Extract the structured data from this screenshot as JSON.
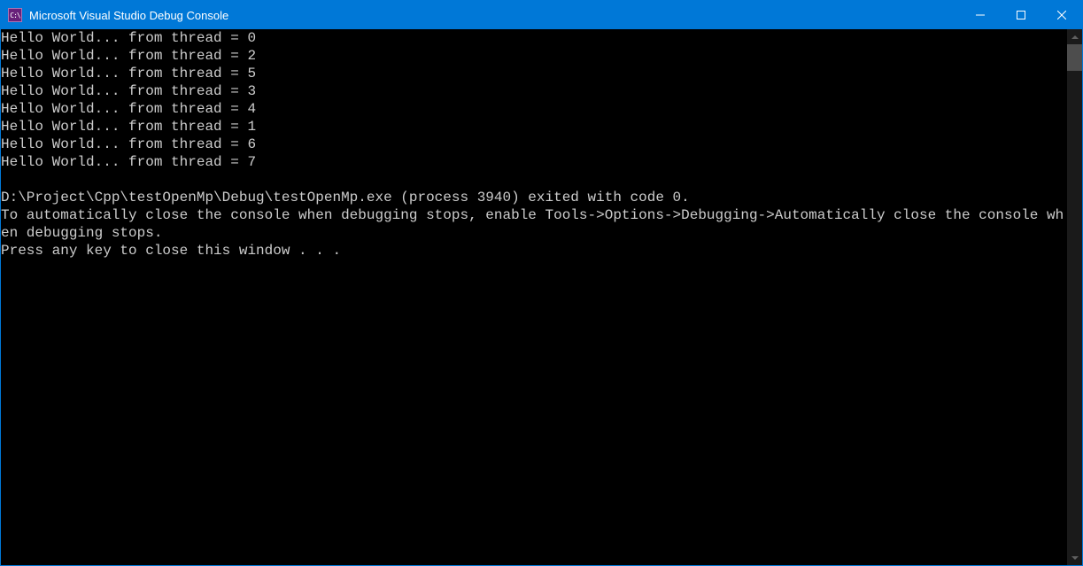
{
  "window": {
    "title": "Microsoft Visual Studio Debug Console"
  },
  "console": {
    "lines": [
      "Hello World... from thread = 0",
      "Hello World... from thread = 2",
      "Hello World... from thread = 5",
      "Hello World... from thread = 3",
      "Hello World... from thread = 4",
      "Hello World... from thread = 1",
      "Hello World... from thread = 6",
      "Hello World... from thread = 7",
      "",
      "D:\\Project\\Cpp\\testOpenMp\\Debug\\testOpenMp.exe (process 3940) exited with code 0.",
      "To automatically close the console when debugging stops, enable Tools->Options->Debugging->Automatically close the console when debugging stops.",
      "Press any key to close this window . . ."
    ]
  }
}
